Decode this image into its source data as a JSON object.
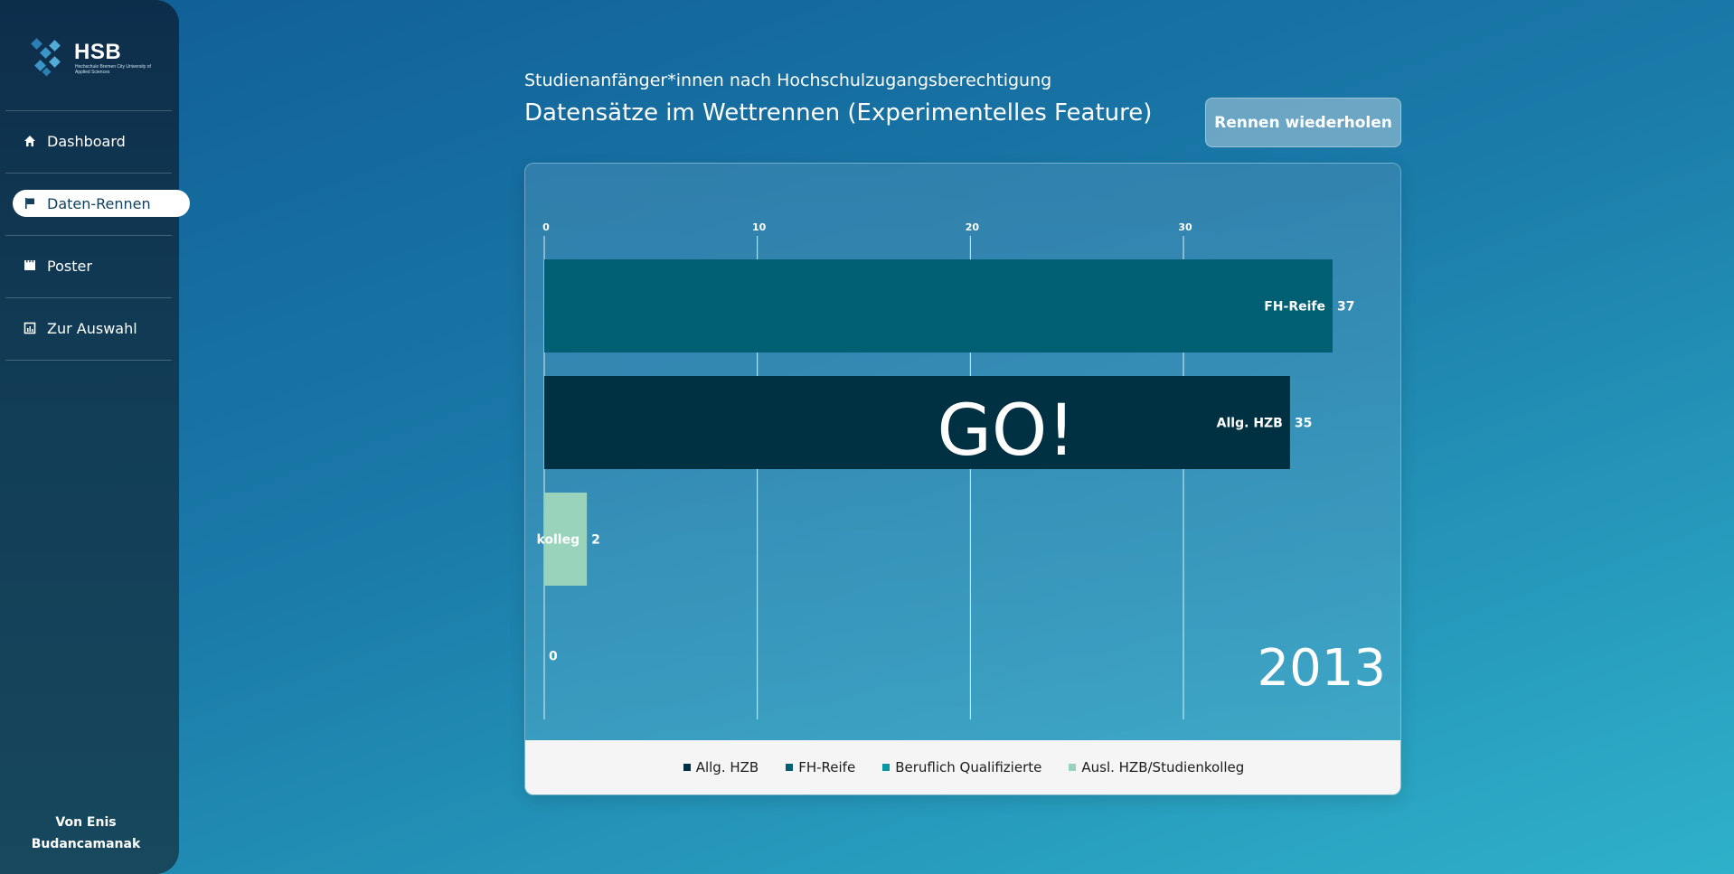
{
  "sidebar": {
    "logo_text": "HSB",
    "logo_sub": "Hochschule Bremen City University of Applied Sciences",
    "items": [
      {
        "label": "Dashboard",
        "icon": "home-icon"
      },
      {
        "label": "Daten-Rennen",
        "icon": "flag-icon",
        "active": true
      },
      {
        "label": "Poster",
        "icon": "film-icon"
      },
      {
        "label": "Zur Auswahl",
        "icon": "chart-icon"
      }
    ],
    "author_line1": "Von Enis",
    "author_line2": "Budancamanak"
  },
  "header": {
    "subtitle": "Studienanfänger*innen nach Hochschulzugangsberechtigung",
    "title": "Datensätze im Wettrennen (Experimentelles Feature)",
    "replay_label": "Rennen wiederholen"
  },
  "overlay": {
    "go_text": "GO!",
    "year": "2013"
  },
  "chart_data": {
    "type": "bar",
    "orientation": "horizontal",
    "xlim": [
      0,
      37
    ],
    "xticks": [
      0,
      10,
      20,
      30
    ],
    "grid": true,
    "bars": [
      {
        "label": "FH-Reife",
        "value": 37,
        "color": "#015f73"
      },
      {
        "label": "Allg. HZB",
        "value": 35,
        "color": "#003142"
      },
      {
        "label": "kolleg",
        "value": 2,
        "color": "#9ad3bc"
      },
      {
        "label": "",
        "value": 0,
        "color": "#0a97a3"
      }
    ],
    "legend": [
      {
        "name": "Allg. HZB",
        "color": "#003142"
      },
      {
        "name": "FH-Reife",
        "color": "#015f73"
      },
      {
        "name": "Beruflich Qualifizierte",
        "color": "#0a97a3"
      },
      {
        "name": "Ausl. HZB/Studienkolleg",
        "color": "#9ad3bc"
      }
    ],
    "legend_position": "bottom"
  }
}
